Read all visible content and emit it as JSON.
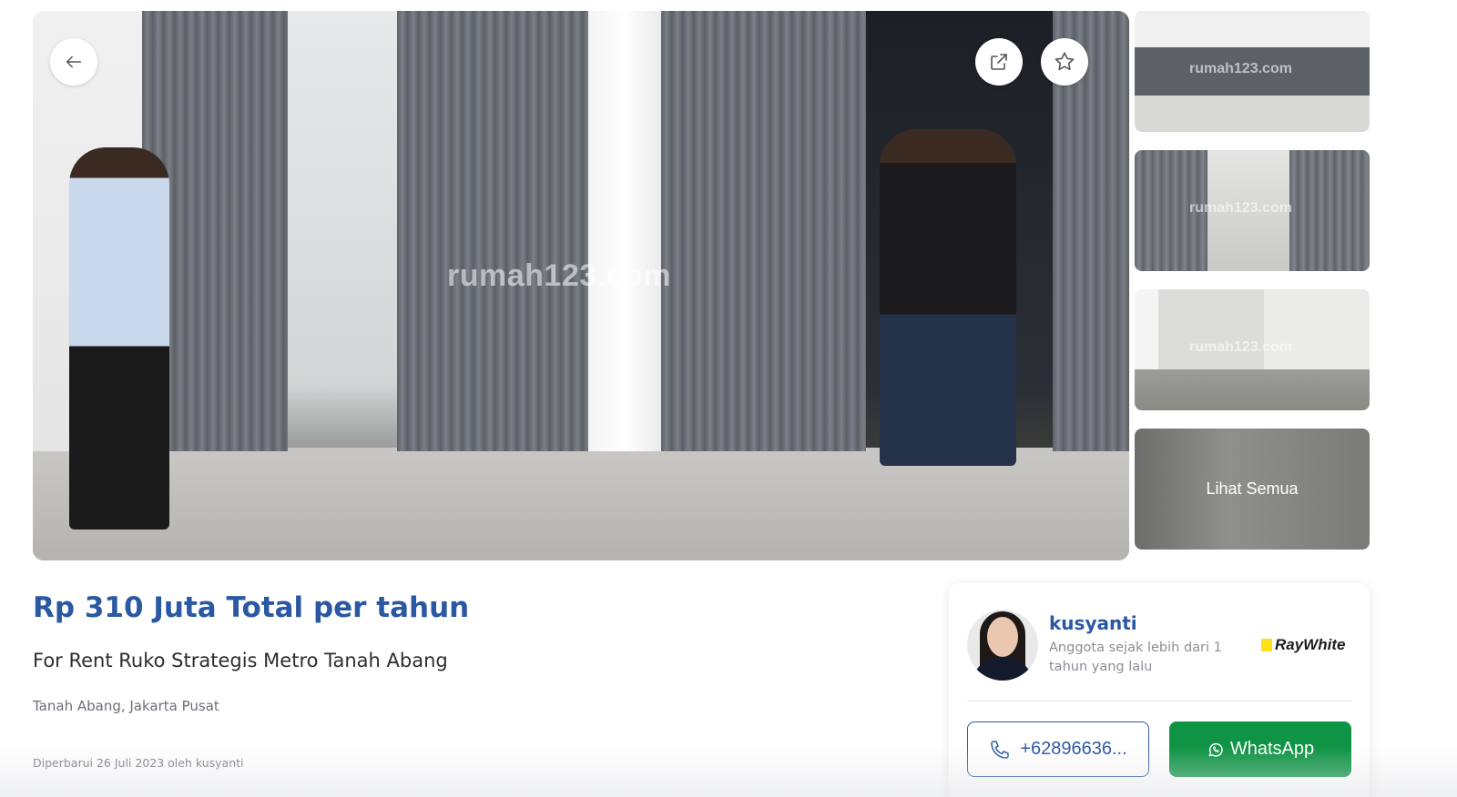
{
  "gallery": {
    "watermark": "rumah123.com",
    "thumbnails": [
      {
        "watermark": "rumah123.com"
      },
      {
        "watermark": "rumah123.com"
      },
      {
        "watermark": "rumah123.com"
      },
      {
        "label": "Lihat Semua"
      }
    ],
    "icons": {
      "back": "arrow-left-icon",
      "share": "share-icon",
      "favorite": "star-icon"
    }
  },
  "listing": {
    "price": "Rp 310 Juta Total per tahun",
    "title": "For Rent Ruko Strategis Metro Tanah Abang",
    "location": "Tanah Abang, Jakarta Pusat",
    "updated": "Diperbarui 26 Juli 2023 oleh kusyanti"
  },
  "agent": {
    "name": "kusyanti",
    "member_since": "Anggota sejak lebih dari 1 tahun yang lalu",
    "agency": "RayWhite",
    "phone_label": "+62896636...",
    "whatsapp_label": "WhatsApp"
  },
  "colors": {
    "brand_blue": "#2a58a3",
    "whatsapp_green": "#0f9344",
    "raywhite_yellow": "#ffe01b"
  }
}
